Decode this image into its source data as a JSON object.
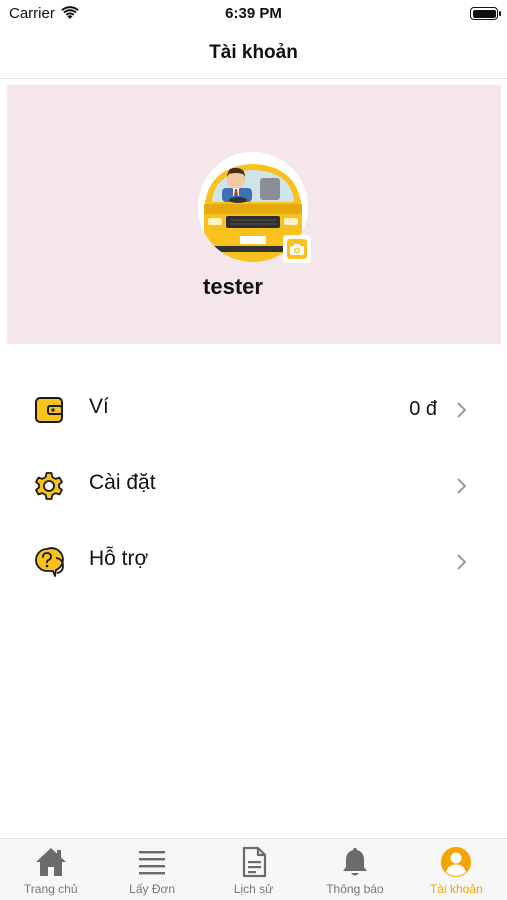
{
  "status_bar": {
    "carrier": "Carrier",
    "time": "6:39 PM",
    "battery_level": 1.0
  },
  "nav": {
    "title": "Tài khoản"
  },
  "profile": {
    "username": "tester",
    "avatar_icon": "taxi-driver-avatar",
    "camera_icon": "camera-icon",
    "background_color": "#f4e6ea"
  },
  "menu": {
    "items": [
      {
        "label": "Ví",
        "value": "0 đ",
        "icon": "wallet-icon"
      },
      {
        "label": "Cài đặt",
        "value": "",
        "icon": "gear-icon"
      },
      {
        "label": "Hỗ trợ",
        "value": "",
        "icon": "help-chat-icon"
      }
    ]
  },
  "tabs": [
    {
      "label": "Trang chủ",
      "icon": "home-icon",
      "active": false
    },
    {
      "label": "Lấy Đơn",
      "icon": "list-icon",
      "active": false
    },
    {
      "label": "Lịch sử",
      "icon": "document-icon",
      "active": false
    },
    {
      "label": "Thông báo",
      "icon": "bell-icon",
      "active": false
    },
    {
      "label": "Tài khoản",
      "icon": "user-circle-icon",
      "active": true
    }
  ],
  "colors": {
    "accent": "#f5a300",
    "icon_gray": "#6b6b6b",
    "icon_yellow": "#f7c21d"
  }
}
